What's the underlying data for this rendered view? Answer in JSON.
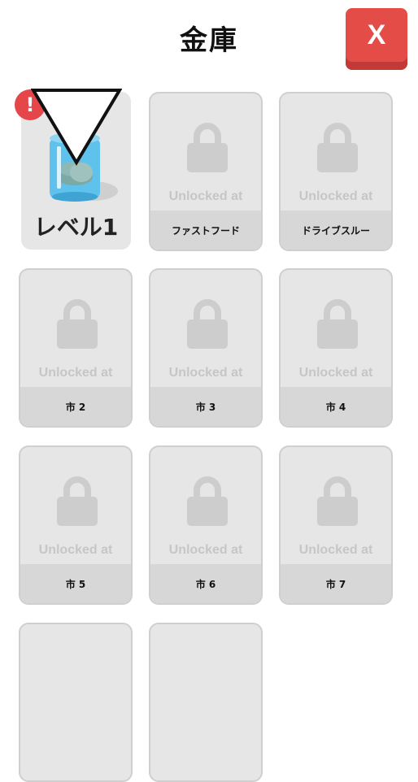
{
  "header": {
    "title": "金庫",
    "close_label": "X"
  },
  "active_card": {
    "badge": "!",
    "label": "レベル1"
  },
  "locked_cards": [
    {
      "unlock_text": "Unlocked at",
      "name": "ファストフード"
    },
    {
      "unlock_text": "Unlocked at",
      "name": "ドライブスルー"
    },
    {
      "unlock_text": "Unlocked at",
      "name": "市 2"
    },
    {
      "unlock_text": "Unlocked at",
      "name": "市 3"
    },
    {
      "unlock_text": "Unlocked at",
      "name": "市 4"
    },
    {
      "unlock_text": "Unlocked at",
      "name": "市 5"
    },
    {
      "unlock_text": "Unlocked at",
      "name": "市 6"
    },
    {
      "unlock_text": "Unlocked at",
      "name": "市 7"
    },
    {
      "unlock_text": "",
      "name": ""
    },
    {
      "unlock_text": "",
      "name": ""
    }
  ],
  "colors": {
    "close_button": "#e44c47",
    "badge": "#e5464a",
    "card_bg": "#e6e6e6"
  }
}
